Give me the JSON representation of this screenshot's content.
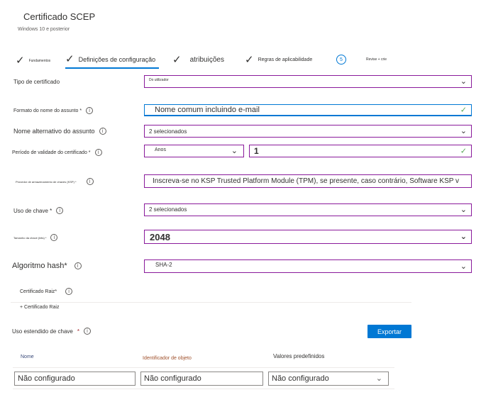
{
  "header": {
    "title": "Certificado SCEP",
    "subtitle": "Windows 10 e posterior"
  },
  "steps": [
    {
      "label": "Fundamentos",
      "state": "done"
    },
    {
      "label": "Definições de configuração",
      "state": "active"
    },
    {
      "label": "atribuições",
      "state": "done"
    },
    {
      "label": "Regras de aplicabilidade",
      "state": "done"
    },
    {
      "number": "5",
      "label": "Revise + crie",
      "state": "pending"
    }
  ],
  "form": {
    "certificate_type": {
      "label": "Tipo de certificado",
      "value": "Do utilizador"
    },
    "subject_name_format": {
      "label": "Formato do nome do assunto *",
      "value": "Nome comum incluindo e-mail"
    },
    "subject_alt_name": {
      "label": "Nome alternativo do assunto",
      "value": "2 selecionados"
    },
    "validity_period": {
      "label": "Período de validade do certificado *",
      "unit": "Anos",
      "value": "1"
    },
    "ksp": {
      "label": "Provedor de armazenamento de chaves (KSP) *",
      "value": "Inscreva-se no KSP Trusted Platform Module (TPM), se presente, caso contrário, Software KSP v"
    },
    "key_usage": {
      "label": "Uso de chave *",
      "value": "2 selecionados"
    },
    "key_size": {
      "label": "Tamanho da chave (bits) *",
      "value": "2048"
    },
    "hash_algorithm": {
      "label": "Algoritmo hash*",
      "value": "SHA-2"
    },
    "root_cert": {
      "label": "Certificado Raiz*",
      "link": "+ Certificado Raiz"
    },
    "eku": {
      "label": "Uso estendido de chave",
      "required_mark": "*",
      "export_label": "Exportar"
    }
  },
  "eku_table": {
    "headers": [
      "Nome",
      "Identificador de objeto",
      "Valores predefinidos"
    ],
    "row": [
      "Não configurado",
      "Não configurado",
      "Não configurado"
    ]
  },
  "colors": {
    "accent": "#0078d4",
    "field_border": "#8a1a9b",
    "valid_tick": "#5aa85a"
  }
}
